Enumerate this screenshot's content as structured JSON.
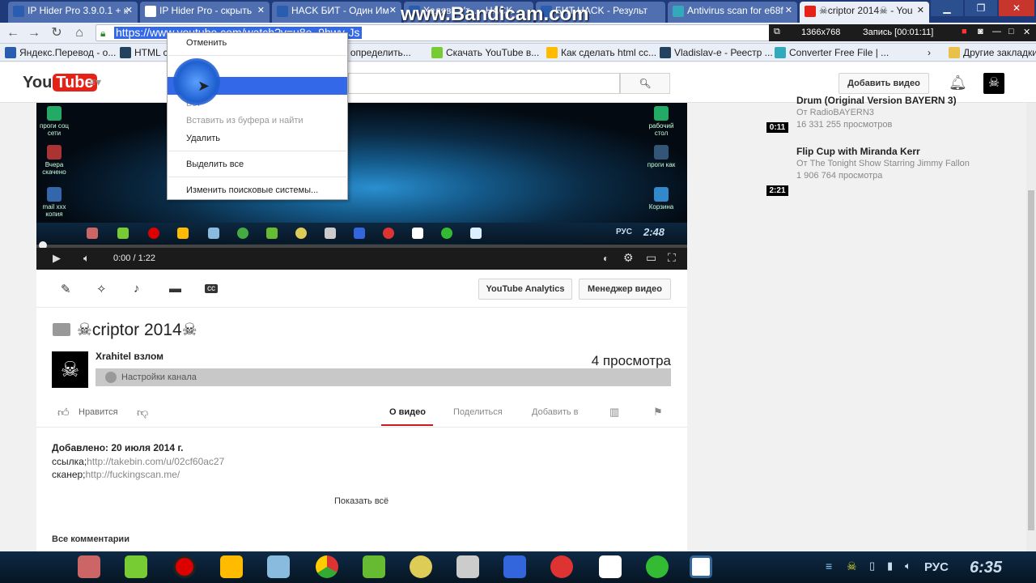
{
  "browser": {
    "tabs": [
      {
        "label": "IP Hider Pro 3.9.0.1 + к",
        "active": false
      },
      {
        "label": "IP Hider Pro - скрыть",
        "active": false
      },
      {
        "label": "HACK БИТ - Один Им",
        "active": false
      },
      {
        "label": "Халява Ут... - HACK",
        "active": false
      },
      {
        "label": "БИТ HACK - Результ",
        "active": false
      },
      {
        "label": "Antivirus scan for e68f",
        "active": false
      },
      {
        "label": "☠criptor 2014☠ - You",
        "active": true
      }
    ],
    "url": "https://www.youtube.com/watch?v=u8e_9hwy-Js",
    "recorder": {
      "resolution": "1366x768",
      "status": "Запись [00:01:11]"
    },
    "bookmarks": [
      "Яндекс.Перевод - о...",
      "HTML c",
      "ать, определить...",
      "Скачать YouTube в...",
      "Как сделать html сс...",
      "Vladislav-e - Реестр ...",
      "Converter Free File | ...",
      "Другие закладки"
    ],
    "watermark": "www.Bandicam.com"
  },
  "context_menu": {
    "items": [
      {
        "label": "Отменить",
        "state": "normal"
      },
      {
        "label": "Вы",
        "state": "normal"
      },
      {
        "label": "",
        "state": "selected"
      },
      {
        "label": "Вст",
        "state": "disabled"
      },
      {
        "label": "Вставить из буфера и найти",
        "state": "disabled"
      },
      {
        "label": "Удалить",
        "state": "normal"
      },
      {
        "label": "Выделить все",
        "state": "normal"
      },
      {
        "label": "Изменить поисковые системы...",
        "state": "normal"
      }
    ]
  },
  "youtube": {
    "logo": {
      "you": "You",
      "tube": "Tube"
    },
    "upload_label": "Добавить видео",
    "player": {
      "time": "0:00 / 1:22",
      "progress": 0.0,
      "desktop_icons": [
        "проги соц сети",
        "Вчера скачено",
        "mail xxx копия",
        "рабочий стол",
        "проги как",
        "Корзина"
      ],
      "inner_lang": "РУС",
      "inner_clock": "2:48"
    },
    "analytics_label": "YouTube Analytics",
    "manager_label": "Менеджер видео",
    "video_title": "☠criptor 2014☠",
    "channel_name": "Xrahitel взлом",
    "channel_settings": "Настройки канала",
    "views": "4 просмотра",
    "like_label": "Нравится",
    "tabs": [
      {
        "label": "О видео",
        "active": true
      },
      {
        "label": "Поделиться",
        "active": false
      },
      {
        "label": "Добавить в",
        "active": false
      }
    ],
    "description": {
      "added": "Добавлено: 20 июля 2014 г.",
      "link_label": "ссылка;",
      "link_url": "http://takebin.com/u/02cf60ac27",
      "scanner_label": "сканер;",
      "scanner_url": "http://fuckingscan.me/"
    },
    "show_all": "Показать всё",
    "all_comments": "Все комментарии",
    "sidebar": [
      {
        "title": "Drum (Original Version BAYERN 3)",
        "by": "От RadioBAYERN3",
        "views": "16 331 255 просмотров",
        "duration": "0:11"
      },
      {
        "title": "Flip Cup with Miranda Kerr",
        "by": "От The Tonight Show Starring Jimmy Fallon",
        "views": "1 906 764 просмотра",
        "duration": "2:21"
      }
    ]
  },
  "taskbar": {
    "lang": "РУС",
    "clock": "6:35"
  },
  "colors": {
    "youtube_red": "#e62117",
    "selection_blue": "#3369e8",
    "tab_strip": "#1f3a78"
  }
}
